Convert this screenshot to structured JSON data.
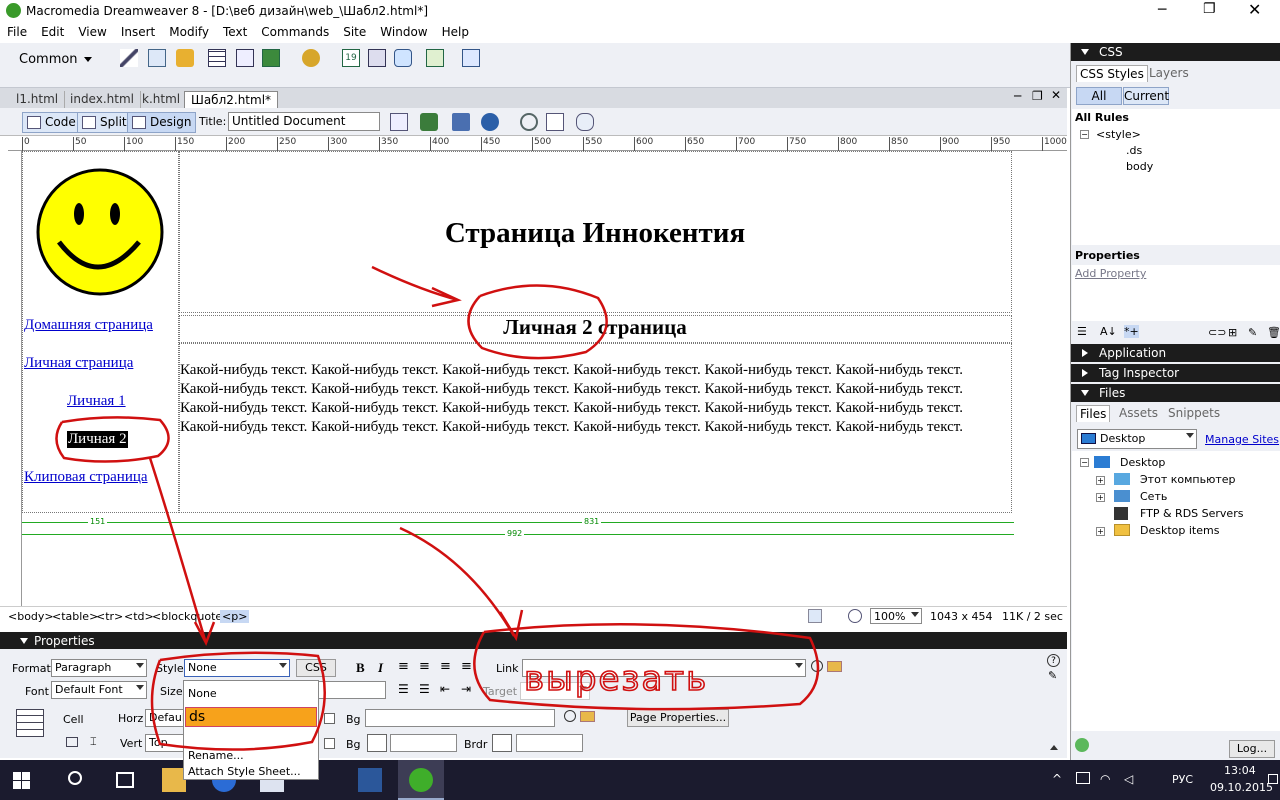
{
  "window": {
    "title": "Macromedia Dreamweaver 8 - [D:\\веб дизайн\\web_\\Шабл2.html*]"
  },
  "menu": [
    "File",
    "Edit",
    "View",
    "Insert",
    "Modify",
    "Text",
    "Commands",
    "Site",
    "Window",
    "Help"
  ],
  "insert_bar": {
    "category": "Common"
  },
  "doc_tabs": [
    "l1.html",
    "index.html",
    "k.html",
    "Шабл2.html*"
  ],
  "doc_toolbar": {
    "code": "Code",
    "split": "Split",
    "design": "Design",
    "title_label": "Title:",
    "title_value": "Untitled Document"
  },
  "ruler_h": [
    "0",
    "50",
    "100",
    "150",
    "200",
    "250",
    "300",
    "350",
    "400",
    "450",
    "500",
    "550",
    "600",
    "650",
    "700",
    "750",
    "800",
    "850",
    "900",
    "950",
    "1000"
  ],
  "page": {
    "heading": "Страница Иннокентия",
    "subheading": "Личная 2 страница",
    "nav": [
      "Домашняя страница",
      "Личная страница",
      "Личная 1",
      "Личная 2",
      "Клиповая страница"
    ],
    "body_text": "Какой-нибудь текст. Какой-нибудь текст. Какой-нибудь текст. Какой-нибудь текст. Какой-нибудь текст. Какой-нибудь текст. Какой-нибудь текст. Какой-нибудь текст. Какой-нибудь текст. Какой-нибудь текст. Какой-нибудь текст. Какой-нибудь текст. Какой-нибудь текст. Какой-нибудь текст. Какой-нибудь текст. Какой-нибудь текст. Какой-нибудь текст. Какой-нибудь текст. Какой-нибудь текст. Какой-нибудь текст. Какой-нибудь текст. Какой-нибудь текст. Какой-нибудь текст. Какой-нибудь текст.",
    "width_markers": [
      "151",
      "831",
      "992"
    ]
  },
  "tag_selector": [
    "<body>",
    "<table>",
    "<tr>",
    "<td>",
    "<blockquote>",
    "<p>"
  ],
  "status": {
    "zoom": "100%",
    "size": "1043 x 454",
    "weight": "11K / 2 sec"
  },
  "properties": {
    "header": "Properties",
    "format_label": "Format",
    "format_value": "Paragraph",
    "style_label": "Style",
    "style_value": "None",
    "css_btn": "CSS",
    "link_label": "Link",
    "font_label": "Font",
    "font_value": "Default Font",
    "size_label": "Size",
    "target_label": "Target",
    "cell_label": "Cell",
    "horz_label": "Horz",
    "horz_value": "Default",
    "vert_label": "Vert",
    "vert_value": "Top",
    "bg_label": "Bg",
    "bg2_label": "Bg",
    "brdr_label": "Brdr",
    "page_props_btn": "Page Properties..."
  },
  "style_dropdown": {
    "items": [
      "None",
      "ds",
      "Rename...",
      "Attach Style Sheet..."
    ]
  },
  "right_panel": {
    "css_header": "CSS",
    "tabs": [
      "CSS Styles",
      "Layers"
    ],
    "mode": [
      "All",
      "Current"
    ],
    "all_rules": "All Rules",
    "rules": [
      "<style>",
      ".ds",
      "body"
    ],
    "properties": "Properties",
    "add_property": "Add Property",
    "application": "Application",
    "tag_inspector": "Tag Inspector",
    "files": "Files",
    "file_tabs": [
      "Files",
      "Assets",
      "Snippets"
    ],
    "site": "Desktop",
    "manage_sites": "Manage Sites",
    "tree": [
      "Desktop",
      "Этот компьютер",
      "Сеть",
      "FTP & RDS Servers",
      "Desktop items"
    ],
    "log_btn": "Log..."
  },
  "annotation": {
    "text": "вырезать"
  },
  "taskbar": {
    "lang": "РУС",
    "time": "13:04",
    "date": "09.10.2015"
  }
}
